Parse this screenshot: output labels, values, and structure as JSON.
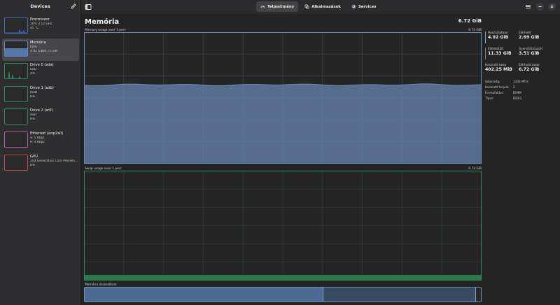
{
  "sidebar": {
    "title": "Devices",
    "items": [
      {
        "name": "Processzor",
        "line1": "20% 3.12 GHz",
        "line2": "45 °C",
        "color": "#3d6fb8",
        "kind": "cpu"
      },
      {
        "name": "Memória",
        "line1": "60%",
        "line2": "4.02 GiB/6.72 GiB",
        "color": "#5c85c0",
        "kind": "mem"
      },
      {
        "name": "Drive 0 (sda)",
        "line1": "SSD",
        "line2": "4%",
        "color": "#2f8a55",
        "kind": "disk0"
      },
      {
        "name": "Drive 1 (sdb)",
        "line1": "HDD",
        "line2": "0%",
        "color": "#2f8a55",
        "kind": "disk"
      },
      {
        "name": "Drive 2 (sr0)",
        "line1": "SSD",
        "line2": "0%",
        "color": "#2f8a55",
        "kind": "disk"
      },
      {
        "name": "Ethernet (enp2s0)",
        "line1": "S: 5 Kbps",
        "line2": "R: 4 Kbps",
        "color": "#b05fa8",
        "kind": "net"
      },
      {
        "name": "GPU",
        "line1": "2nd Generation Core Processor Family Integrated Graphics Controller",
        "line2": "0%",
        "color": "#c84a4a",
        "kind": "gpu"
      }
    ]
  },
  "tabs": [
    {
      "label": "Teljesítmény",
      "icon": "gauge-icon",
      "active": true
    },
    {
      "label": "Alkalmazások",
      "icon": "apps-icon",
      "active": false
    },
    {
      "label": "Services",
      "icon": "gear-icon",
      "active": false
    }
  ],
  "main": {
    "title": "Memória",
    "total": "6.72 GiB",
    "memory_graph_label": "Memory usage over 1 perc",
    "memory_graph_max": "6.72 GiB",
    "swap_graph_label": "Swap usage over 1 perc",
    "swap_graph_max": "6.72 GiB",
    "composition_label": "Memória összetétele",
    "memory_fraction": 0.6,
    "swap_fraction": 0.0,
    "composition_fractions": {
      "used": 0.6,
      "cached": 0.385
    }
  },
  "stats": {
    "used_label": "Használatban",
    "used_value": "4.02 GiB",
    "available_label": "Elérhető",
    "available_value": "2.69 GiB",
    "committed_label": "Előlekötött",
    "committed_value": "11.33 GiB",
    "cached_label": "Gyorsítótárazott",
    "cached_value": "3.51 GiB",
    "swap_used_label": "Használt swap",
    "swap_used_value": "402.25 MiB",
    "swap_avail_label": "Elérhető swap",
    "swap_avail_value": "6.72 GiB",
    "info": [
      {
        "k": "Sebesség:",
        "v": "1333 MT/s"
      },
      {
        "k": "Használt helyek:",
        "v": "2"
      },
      {
        "k": "Formafaktor:",
        "v": "DIMM"
      },
      {
        "k": "Típus:",
        "v": "DDR3"
      }
    ]
  },
  "colors": {
    "memory": "#6b8cba",
    "swap": "#2f8a55",
    "accent": "#6fa3e0"
  }
}
